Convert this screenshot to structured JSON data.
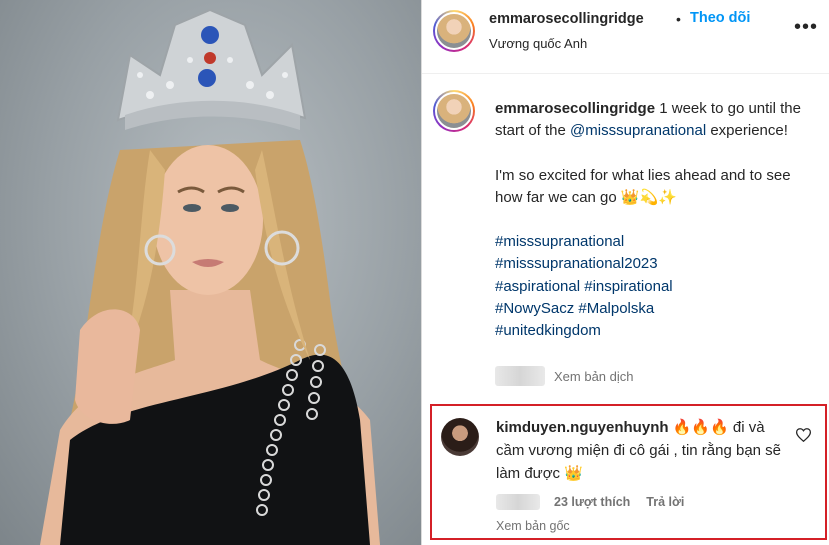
{
  "post": {
    "username": "emmarosecollingridge",
    "follow_label": "Theo dõi",
    "separator": "•",
    "location": "Vương quốc Anh",
    "more_icon": "more-horizontal-icon"
  },
  "caption": {
    "username": "emmarosecollingridge",
    "text_1": " 1 week to go until the start of the ",
    "mention": "@misssupranational",
    "text_2": " experience!",
    "paragraph_2": "I'm so excited for what lies ahead and to see how far we can go 👑💫✨",
    "hashtags": [
      "#misssupranational",
      "#misssupranational2023",
      "#aspirational #inspirational",
      "#NowySacz #Malpolska",
      "#unitedkingdom"
    ],
    "translate_label": "Xem bản dịch"
  },
  "comment": {
    "username": "kimduyen.nguyenhuynh",
    "text": " 🔥🔥🔥 đi và cầm vương miện đi cô gái , tin rằng bạn sẽ làm được 👑",
    "likes_label": "23 lượt thích",
    "reply_label": "Trả lời",
    "original_label": "Xem bản gốc",
    "highlight_color": "#d42027"
  },
  "colors": {
    "link": "#00376b",
    "follow": "#0095f6",
    "muted": "#737373"
  }
}
